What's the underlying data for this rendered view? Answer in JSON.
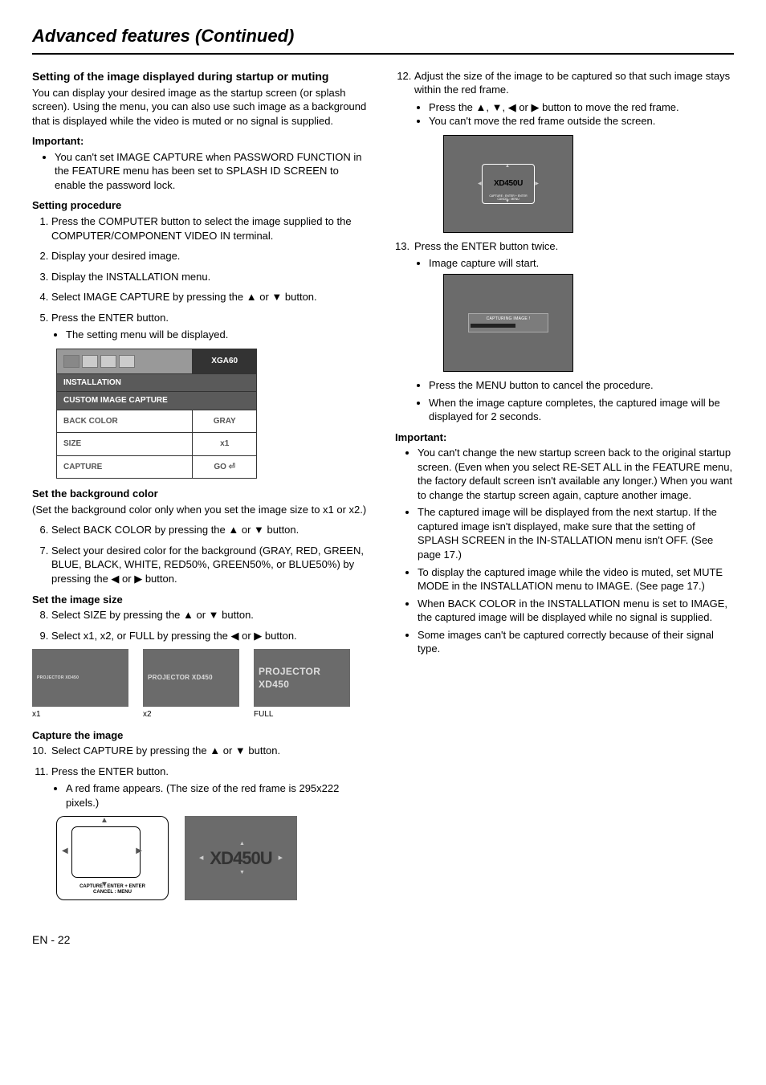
{
  "page_title": "Advanced features (Continued)",
  "footer": "EN - 22",
  "left": {
    "h1": "Setting of the image displayed during startup or muting",
    "intro": "You can display your desired image as the startup screen (or splash screen). Using the menu, you can also use such image as a background that is displayed while the video is muted or no signal is supplied.",
    "important_label": "Important:",
    "important_bullet": "You can't set IMAGE CAPTURE when PASSWORD FUNCTION in the FEATURE menu has been set to SPLASH ID SCREEN to enable the password lock.",
    "setting_procedure_label": "Setting procedure",
    "step1": "Press the COMPUTER button to select the image supplied to the COMPUTER/COMPONENT VIDEO IN terminal.",
    "step2": "Display your desired image.",
    "step3": "Display the INSTALLATION menu.",
    "step4": "Select IMAGE CAPTURE by pressing the ▲ or ▼ button.",
    "step5": "Press the ENTER button.",
    "step5_sub": "The setting menu will be displayed.",
    "menu": {
      "top_right": "XGA60",
      "row1": "INSTALLATION",
      "row2": "CUSTOM IMAGE CAPTURE",
      "back_color_label": "BACK COLOR",
      "back_color_val": "GRAY",
      "size_label": "SIZE",
      "size_val": "x1",
      "capture_label": "CAPTURE",
      "capture_val": "GO ⏎"
    },
    "set_bg_label": "Set the background color",
    "set_bg_note": "(Set the background color only when you set the image size to x1 or x2.)",
    "step6": "Select BACK COLOR by pressing the ▲ or ▼ button.",
    "step7": "Select your desired color for the background (GRAY, RED, GREEN, BLUE, BLACK, WHITE, RED50%, GREEN50%, or  BLUE50%) by pressing the ◀ or ▶ button.",
    "set_size_label": "Set the image size",
    "step8": "Select SIZE by pressing the ▲ or ▼ button.",
    "step9": "Select x1, x2, or FULL by pressing the ◀ or ▶ button.",
    "thumb_text": "PROJECTOR XD450",
    "thumb_x1": "x1",
    "thumb_x2": "x2",
    "thumb_full": "FULL",
    "capture_label": "Capture the image",
    "step10": "Select CAPTURE by pressing the ▲ or ▼ button.",
    "step11": "Press the ENTER button.",
    "step11_sub": "A red frame appears.  (The size of the red frame is 295x222 pixels.)",
    "frame_caption": "CAPTURE : ENTER + ENTER\nCANCEL : MENU",
    "frame_xd": "XD450U"
  },
  "right": {
    "step12": "Adjust the size of the image to be captured so that such image stays within the red frame.",
    "step12_sub1": "Press the ▲, ▼, ◀ or ▶ button to move the red frame.",
    "step12_sub2": "You can't move the red frame outside the screen.",
    "r_xd": "XD450U",
    "r_caption": "CAPTURE : ENTER + ENTER\nCANCEL : MENU",
    "step13": "Press the ENTER button twice.",
    "step13_sub": "Image capture will start.",
    "capturing_label": "CAPTURING IMAGE !",
    "post_bullet1": "Press the MENU button to cancel the procedure.",
    "post_bullet2": "When the image capture completes, the captured image will be displayed for 2 seconds.",
    "important_label": "Important:",
    "imp1": "You can't change the new startup screen back to the original startup screen.  (Even when you select RE-SET ALL in the FEATURE menu, the factory default screen isn't available any longer.)  When you want to change the startup screen again, capture another image.",
    "imp2": "The captured image will be displayed from the next startup.  If the captured image isn't displayed, make sure that the setting of SPLASH SCREEN in the IN-STALLATION menu isn't OFF.  (See page 17.)",
    "imp3": "To display the captured image while the video is muted, set MUTE MODE in the INSTALLATION menu to IMAGE.  (See page 17.)",
    "imp4": "When BACK COLOR in the INSTALLATION menu is set to IMAGE, the captured image will be displayed while no signal is supplied.",
    "imp5": "Some images can't be captured correctly because of their signal type."
  }
}
